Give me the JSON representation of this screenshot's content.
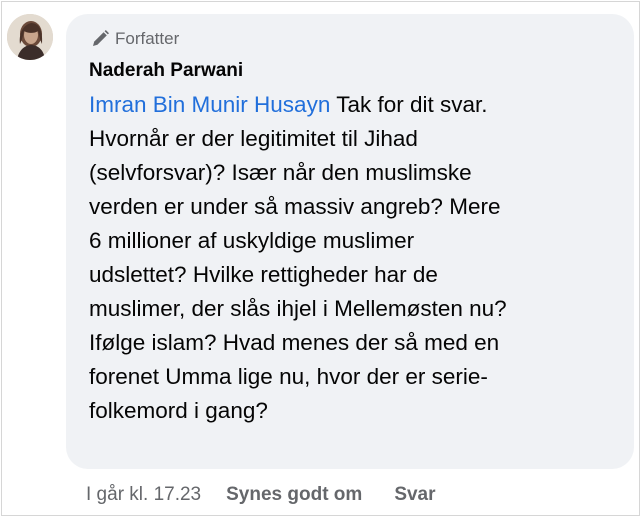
{
  "comment": {
    "author_badge": "Forfatter",
    "author_badge_icon": "pen-icon",
    "author_name": "Naderah Parwani",
    "mention": "Imran Bin Munir Husayn",
    "lines": [
      " Tak for dit svar.",
      "Hvornår er der legitimitet til Jihad",
      "(selvforsvar)? Især når den muslimske",
      "verden er under så massiv angreb? Mere",
      "6 millioner af uskyldige muslimer",
      "udslettet? Hvilke rettigheder har de",
      "muslimer, der slås ihjel i Mellemøsten nu?",
      "Ifølge islam? Hvad menes der så med en",
      "forenet Umma lige nu, hvor der er serie-",
      "folkemord i gang?"
    ],
    "timestamp": "I går kl. 17.23",
    "like_label": "Synes godt om",
    "reply_label": "Svar"
  },
  "colors": {
    "bubble": "#f0f2f5",
    "mention": "#216fdb",
    "meta_text": "#65676b",
    "text": "#050505"
  }
}
